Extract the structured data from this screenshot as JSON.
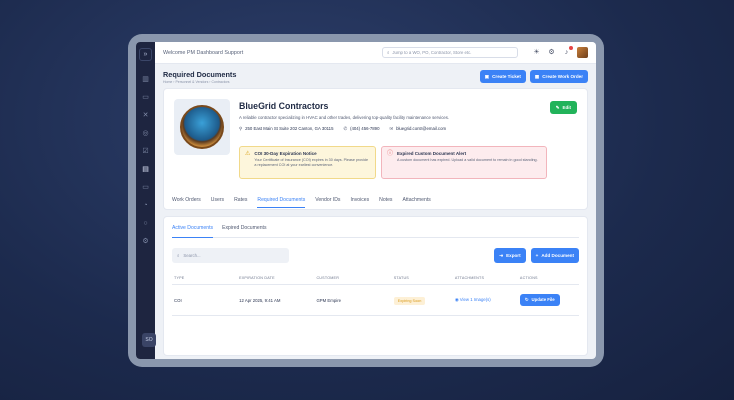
{
  "topbar": {
    "welcome": "Welcome PM Dashboard Support",
    "search_placeholder": "Jump to a WO, PO, Contractor, Store etc."
  },
  "rail": {
    "user_initials": "SO"
  },
  "page": {
    "title": "Required Documents",
    "breadcrumb": "Home › Personnel & Vendors › Contractors",
    "create_ticket": "Create Ticket",
    "create_work_order": "Create Work Order"
  },
  "contractor": {
    "name": "BlueGrid Contractors",
    "description": "A reliable contractor specializing in HVAC and other trades, delivering top-quality facility maintenance services.",
    "address": "250 East Main St Suite 202 Canton, GA 30115",
    "phone": "(404) 456-7890",
    "email": "bluegrid.contr@email.com",
    "edit_label": "Edit"
  },
  "alerts": {
    "warning": {
      "title": "COI 30-Day Expiration Notice",
      "text": "Your Certificate of Insurance (COI) expires in 30 days. Please provide a replacement COI at your earliest convenience."
    },
    "error": {
      "title": "Expired Custom Document Alert",
      "text": "A custom document has expired. Upload a valid document to remain in good standing."
    }
  },
  "tabs": [
    "Work Orders",
    "Users",
    "Rates",
    "Required Documents",
    "Vendor IDs",
    "Invoices",
    "Notes",
    "Attachments"
  ],
  "docs": {
    "subtabs": [
      "Active Documents",
      "Expired Documents"
    ],
    "search_placeholder": "Search...",
    "export_label": "Export",
    "add_label": "Add Document",
    "columns": [
      "TYPE",
      "EXPIRATION DATE",
      "CUSTOMER",
      "STATUS",
      "ATTACHMENTS",
      "ACTIONS"
    ],
    "rows": [
      {
        "type": "COI",
        "expiration": "12 Apr 2025, 9:41 AM",
        "customer": "GPM Empire",
        "status": "Expiring Soon",
        "attachments": "View 1 Image(s)",
        "action": "Update File"
      }
    ]
  },
  "colors": {
    "accent": "#3b82f6",
    "success": "#22b35a",
    "warning": "#d9a21a",
    "danger": "#e05555"
  }
}
